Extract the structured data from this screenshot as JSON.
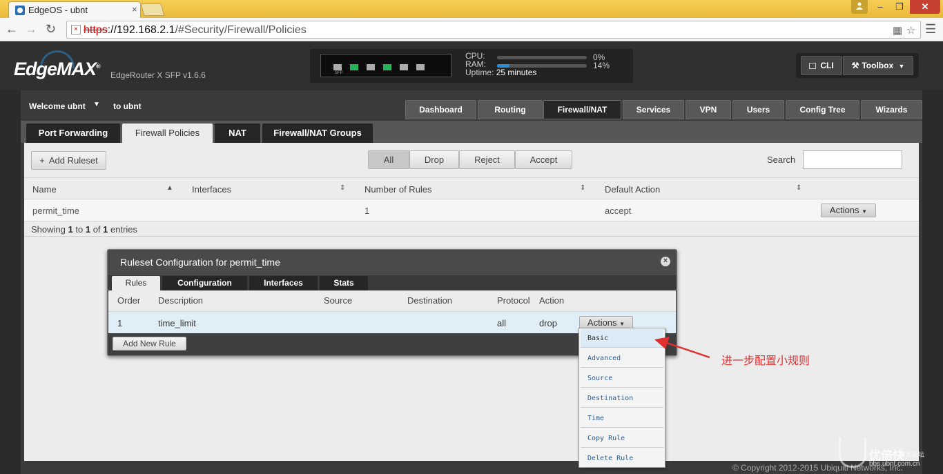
{
  "browser": {
    "tab_title": "EdgeOS - ubnt",
    "tab_close": "×",
    "url_proto": "https",
    "url_host": "://192.168.2.1",
    "url_path": "/#Security/Firewall/Policies",
    "win_min": "–",
    "win_max": "❐",
    "win_close": "✕"
  },
  "header": {
    "logo": "EdgeMAX",
    "logo_mark": "®",
    "model": "EdgeRouter X SFP v1.6.6",
    "sfp_label": "SFP",
    "cpu_label": "CPU:",
    "ram_label": "RAM:",
    "uptime_label": "Uptime:",
    "cpu_pct": "0%",
    "ram_pct": "14%",
    "cpu_value": 0,
    "ram_value": 14,
    "uptime": "25 minutes",
    "cli": "CLI",
    "toolbox": "Toolbox",
    "ports_up": [
      false,
      true,
      false,
      true,
      false,
      false
    ]
  },
  "user": {
    "welcome": "Welcome ubnt",
    "to": "to ubnt"
  },
  "main_nav": [
    "Dashboard",
    "Routing",
    "Firewall/NAT",
    "Services",
    "VPN",
    "Users",
    "Config Tree",
    "Wizards"
  ],
  "main_nav_active": "Firewall/NAT",
  "sub_tabs": [
    "Port Forwarding",
    "Firewall Policies",
    "NAT",
    "Firewall/NAT Groups"
  ],
  "sub_tabs_active": "Firewall Policies",
  "toolbar": {
    "add_ruleset": "Add Ruleset",
    "filters": [
      "All",
      "Drop",
      "Reject",
      "Accept"
    ],
    "filter_active": "All",
    "search_label": "Search",
    "search_value": ""
  },
  "rulesets_table": {
    "columns": [
      "Name",
      "Interfaces",
      "Number of Rules",
      "Default Action"
    ],
    "rows": [
      {
        "name": "permit_time",
        "interfaces": "",
        "rules": "1",
        "default_action": "accept",
        "actions": "Actions"
      }
    ],
    "showing_prefix": "Showing",
    "showing_from": "1",
    "showing_to_word": "to",
    "showing_to": "1",
    "showing_of_word": "of",
    "showing_total": "1",
    "showing_suffix": "entries"
  },
  "dialog": {
    "title": "Ruleset Configuration for permit_time",
    "tabs": [
      "Rules",
      "Configuration",
      "Interfaces",
      "Stats"
    ],
    "tab_active": "Rules",
    "columns": [
      "Order",
      "Description",
      "Source",
      "Destination",
      "Protocol",
      "Action"
    ],
    "rows": [
      {
        "order": "1",
        "description": "time_limit",
        "source": "",
        "destination": "",
        "protocol": "all",
        "action": "drop",
        "actions": "Actions"
      }
    ],
    "add_rule": "Add New Rule"
  },
  "actions_menu": {
    "items": [
      "Basic",
      "Advanced",
      "Source",
      "Destination",
      "Time",
      "Copy Rule",
      "Delete Rule"
    ],
    "highlighted": "Basic"
  },
  "annotation": "进一步配置小规则",
  "copyright": "© Copyright 2012-2015 Ubiquiti Networks, Inc.",
  "watermark": {
    "brand": "优倍快",
    "sub": "技术论坛",
    "url": "bbs.ubnt.com.cn"
  },
  "colors": {
    "accent_blue": "#2a8fd4",
    "port_up": "#26b45a",
    "annotation_red": "#e03030"
  }
}
